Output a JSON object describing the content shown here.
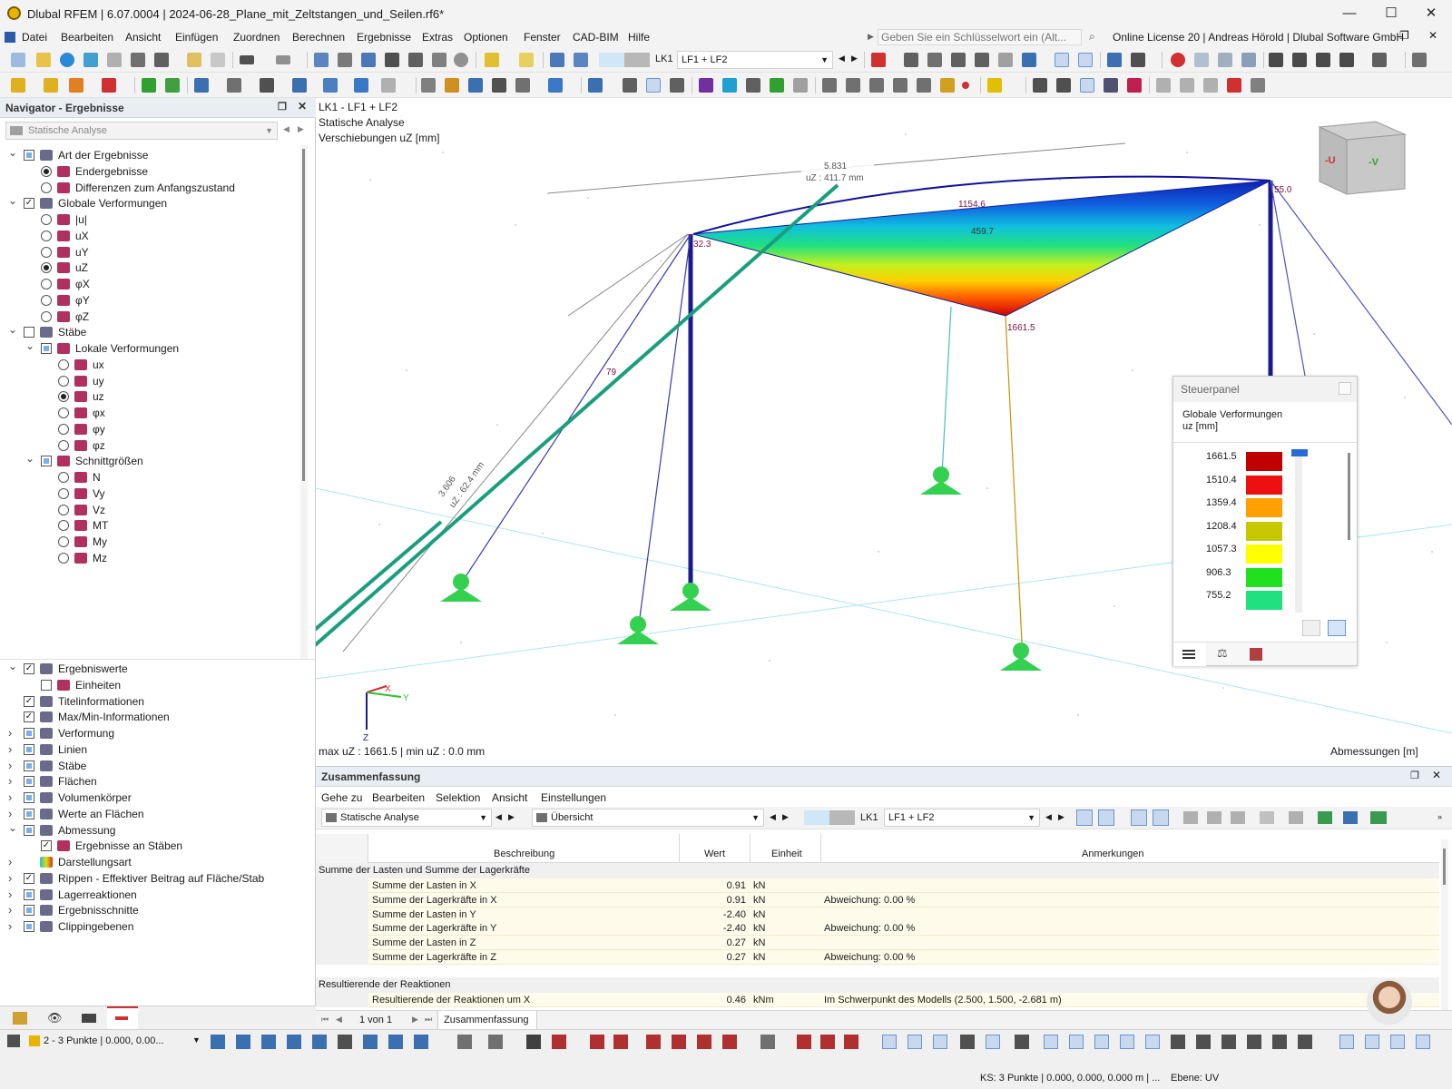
{
  "window": {
    "title": "Dlubal RFEM | 6.07.0004 | 2024-06-28_Plane_mit_Zeltstangen_und_Seilen.rf6*"
  },
  "menu": [
    "Datei",
    "Bearbeiten",
    "Ansicht",
    "Einfügen",
    "Zuordnen",
    "Berechnen",
    "Ergebnisse",
    "Extras",
    "Optionen",
    "Fenster",
    "CAD-BIM",
    "Hilfe"
  ],
  "search": {
    "placeholder": "Geben Sie ein Schlüsselwort ein (Alt..."
  },
  "license": "Online License 20 | Andreas Hörold | Dlubal Software GmbH",
  "toolbar": {
    "lc_id": "LK1",
    "lc_name": "LF1 + LF2"
  },
  "navigator": {
    "title": "Navigator - Ergebnisse",
    "analysis": "Statische Analyse",
    "items": [
      {
        "t": "Art der Ergebnisse",
        "lvl": 0,
        "ctl": "cb",
        "st": "sq",
        "exp": "v"
      },
      {
        "t": "Endergebnisse",
        "lvl": 1,
        "ctl": "rb",
        "st": "on"
      },
      {
        "t": "Differenzen zum Anfangszustand",
        "lvl": 1,
        "ctl": "rb",
        "st": ""
      },
      {
        "t": "Globale Verformungen",
        "lvl": 0,
        "ctl": "cb",
        "st": "chk",
        "exp": "v"
      },
      {
        "t": "|u|",
        "lvl": 1,
        "ctl": "rb",
        "st": ""
      },
      {
        "t": "uX",
        "lvl": 1,
        "ctl": "rb",
        "st": ""
      },
      {
        "t": "uY",
        "lvl": 1,
        "ctl": "rb",
        "st": ""
      },
      {
        "t": "uZ",
        "lvl": 1,
        "ctl": "rb",
        "st": "on"
      },
      {
        "t": "φX",
        "lvl": 1,
        "ctl": "rb",
        "st": ""
      },
      {
        "t": "φY",
        "lvl": 1,
        "ctl": "rb",
        "st": ""
      },
      {
        "t": "φZ",
        "lvl": 1,
        "ctl": "rb",
        "st": ""
      },
      {
        "t": "Stäbe",
        "lvl": 0,
        "ctl": "cb",
        "st": "",
        "exp": "v"
      },
      {
        "t": "Lokale Verformungen",
        "lvl": 1,
        "ctl": "cb",
        "st": "sq",
        "exp": "v"
      },
      {
        "t": "ux",
        "lvl": 2,
        "ctl": "rb",
        "st": ""
      },
      {
        "t": "uy",
        "lvl": 2,
        "ctl": "rb",
        "st": ""
      },
      {
        "t": "uz",
        "lvl": 2,
        "ctl": "rb",
        "st": "on"
      },
      {
        "t": "φx",
        "lvl": 2,
        "ctl": "rb",
        "st": ""
      },
      {
        "t": "φy",
        "lvl": 2,
        "ctl": "rb",
        "st": ""
      },
      {
        "t": "φz",
        "lvl": 2,
        "ctl": "rb",
        "st": ""
      },
      {
        "t": "Schnittgrößen",
        "lvl": 1,
        "ctl": "cb",
        "st": "sq",
        "exp": "v"
      },
      {
        "t": "N",
        "lvl": 2,
        "ctl": "rb",
        "st": ""
      },
      {
        "t": "Vy",
        "lvl": 2,
        "ctl": "rb",
        "st": ""
      },
      {
        "t": "Vz",
        "lvl": 2,
        "ctl": "rb",
        "st": ""
      },
      {
        "t": "MT",
        "lvl": 2,
        "ctl": "rb",
        "st": ""
      },
      {
        "t": "My",
        "lvl": 2,
        "ctl": "rb",
        "st": ""
      },
      {
        "t": "Mz",
        "lvl": 2,
        "ctl": "rb",
        "st": ""
      }
    ],
    "items2": [
      {
        "t": "Ergebniswerte",
        "lvl": 0,
        "ctl": "cb",
        "st": "chk",
        "exp": "v"
      },
      {
        "t": "Einheiten",
        "lvl": 1,
        "ctl": "cb",
        "st": ""
      },
      {
        "t": "Titelinformationen",
        "lvl": 0,
        "ctl": "cb",
        "st": "chk",
        "exp": ""
      },
      {
        "t": "Max/Min-Informationen",
        "lvl": 0,
        "ctl": "cb",
        "st": "chk",
        "exp": ""
      },
      {
        "t": "Verformung",
        "lvl": 0,
        "ctl": "cb",
        "st": "sq",
        "exp": ">"
      },
      {
        "t": "Linien",
        "lvl": 0,
        "ctl": "cb",
        "st": "sq",
        "exp": ">"
      },
      {
        "t": "Stäbe",
        "lvl": 0,
        "ctl": "cb",
        "st": "sq",
        "exp": ">"
      },
      {
        "t": "Flächen",
        "lvl": 0,
        "ctl": "cb",
        "st": "sq",
        "exp": ">"
      },
      {
        "t": "Volumenkörper",
        "lvl": 0,
        "ctl": "cb",
        "st": "sq",
        "exp": ">"
      },
      {
        "t": "Werte an Flächen",
        "lvl": 0,
        "ctl": "cb",
        "st": "sq",
        "exp": ">"
      },
      {
        "t": "Abmessung",
        "lvl": 0,
        "ctl": "cb",
        "st": "sq",
        "exp": "v"
      },
      {
        "t": "Ergebnisse an Stäben",
        "lvl": 1,
        "ctl": "cb",
        "st": "chk"
      },
      {
        "t": "Darstellungsart",
        "lvl": 0,
        "ctl": "none",
        "st": "",
        "exp": ">"
      },
      {
        "t": "Rippen - Effektiver Beitrag auf Fläche/Stab",
        "lvl": 0,
        "ctl": "cb",
        "st": "chk",
        "exp": ">"
      },
      {
        "t": "Lagerreaktionen",
        "lvl": 0,
        "ctl": "cb",
        "st": "sq",
        "exp": ">"
      },
      {
        "t": "Ergebnisschnitte",
        "lvl": 0,
        "ctl": "cb",
        "st": "sq",
        "exp": ">"
      },
      {
        "t": "Clippingebenen",
        "lvl": 0,
        "ctl": "cb",
        "st": "sq",
        "exp": ">"
      }
    ]
  },
  "viewport": {
    "line1": "LK1 - LF1 + LF2",
    "line2": "Statische Analyse",
    "line3": "Verschiebungen uZ [mm]",
    "maxmin": "max uZ : 1661.5 | min uZ : 0.0 mm",
    "units": "Abmessungen [m]",
    "labels": {
      "a": "32.3",
      "b": "55.0",
      "c": "1154.6",
      "d": "459.7",
      "e": "1661.5",
      "f": "79",
      "dim1a": "5.831",
      "dim1b": "uZ : 411.7 mm",
      "dim2a": "3.606",
      "dim2b": "uZ : 62.4 mm"
    },
    "cube": {
      "left": "-U",
      "right": "-V"
    }
  },
  "panel": {
    "title": "Steuerpanel",
    "sub1": "Globale Verformungen",
    "sub2": "uz [mm]",
    "legend": [
      {
        "v": "1661.5",
        "c": "#c00000"
      },
      {
        "v": "1510.4",
        "c": "#ee1010"
      },
      {
        "v": "1359.4",
        "c": "#ffa000"
      },
      {
        "v": "1208.4",
        "c": "#c8c800"
      },
      {
        "v": "1057.3",
        "c": "#ffff00"
      },
      {
        "v": "906.3",
        "c": "#20e020"
      },
      {
        "v": "755.2",
        "c": "#20e080"
      }
    ]
  },
  "summary": {
    "title": "Zusammenfassung",
    "menu": [
      "Gehe zu",
      "Bearbeiten",
      "Selektion",
      "Ansicht",
      "Einstellungen"
    ],
    "analysis": "Statische Analyse",
    "view": "Übersicht",
    "lc_id": "LK1",
    "lc_name": "LF1 + LF2",
    "headers": [
      "Beschreibung",
      "Wert",
      "Einheit",
      "Anmerkungen"
    ],
    "group1": "Summe der Lasten und Summe der Lagerkräfte",
    "rows": [
      [
        "Summe der Lasten in X",
        "0.91",
        "kN",
        ""
      ],
      [
        "Summe der Lagerkräfte in X",
        "0.91",
        "kN",
        "Abweichung: 0.00 %"
      ],
      [
        "Summe der Lasten in Y",
        "-2.40",
        "kN",
        ""
      ],
      [
        "Summe der Lagerkräfte in Y",
        "-2.40",
        "kN",
        "Abweichung: 0.00 %"
      ],
      [
        "Summe der Lasten in Z",
        "0.27",
        "kN",
        ""
      ],
      [
        "Summe der Lagerkräfte in Z",
        "0.27",
        "kN",
        "Abweichung: 0.00 %"
      ]
    ],
    "group2": "Resultierende der Reaktionen",
    "rows2": [
      [
        "Resultierende der Reaktionen um X",
        "0.46",
        "kNm",
        "Im Schwerpunkt des Modells (2.500, 1.500, -2.681 m)"
      ]
    ],
    "pager": "1 von 1",
    "tab": "Zusammenfassung"
  },
  "status": {
    "left": "2 - 3 Punkte | 0.000, 0.00...",
    "ks": "KS: 3 Punkte | 0.000, 0.000, 0.000 m | ...",
    "plane": "Ebene: UV"
  },
  "colors": {
    "accent": "#1a9e7e",
    "navhead": "#e9eef5",
    "mesh_max": "#d00000",
    "mesh_min": "#1010b0"
  }
}
